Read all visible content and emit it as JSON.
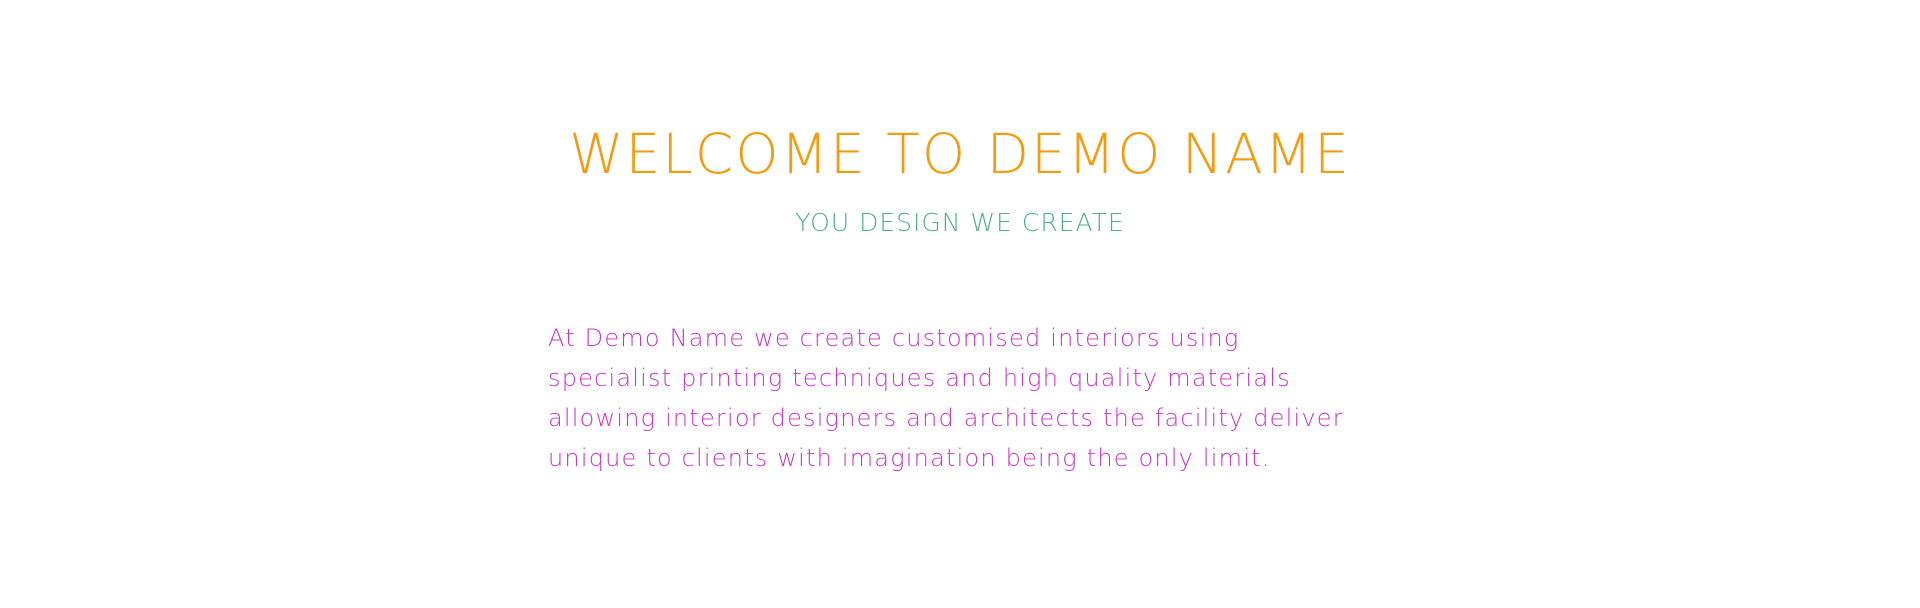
{
  "welcome": {
    "title": "WELCOME TO DEMO NAME",
    "subtitle": "YOU DESIGN WE CREATE",
    "intro_lines": [
      "At Demo Name we create customised interiors using",
      "specialist printing techniques and high quality materials",
      "allowing interior designers and architects the facility deliver",
      "unique to clients with imagination being the only limit."
    ]
  },
  "colors": {
    "title": "#f39c12",
    "subtitle": "#4caf8e",
    "body_text": "#cc33cc",
    "background": "#ffffff"
  }
}
